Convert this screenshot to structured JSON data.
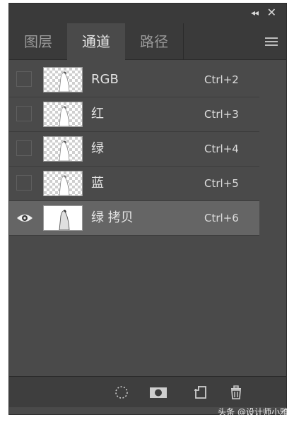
{
  "panel": {
    "collapse_glyph": "◂◂",
    "close_glyph": "✕",
    "tabs": [
      {
        "label": "图层",
        "active": false
      },
      {
        "label": "通道",
        "active": true
      },
      {
        "label": "路径",
        "active": false
      }
    ],
    "channels": [
      {
        "name": "RGB",
        "shortcut": "Ctrl+2",
        "visible": false,
        "selected": false
      },
      {
        "name": "红",
        "shortcut": "Ctrl+3",
        "visible": false,
        "selected": false
      },
      {
        "name": "绿",
        "shortcut": "Ctrl+4",
        "visible": false,
        "selected": false
      },
      {
        "name": "蓝",
        "shortcut": "Ctrl+5",
        "visible": false,
        "selected": false
      },
      {
        "name": "绿 拷贝",
        "shortcut": "Ctrl+6",
        "visible": true,
        "selected": true
      }
    ],
    "bottom_icons": [
      "selection-icon",
      "mask-icon",
      "new-channel-icon",
      "trash-icon"
    ]
  },
  "watermark": "头条 @设计师小雅",
  "colors": {
    "panel_bg": "#4a4a4a",
    "tab_bar_bg": "#3a3a3a",
    "selected_row": "#656565",
    "text": "#e4e4e4"
  }
}
